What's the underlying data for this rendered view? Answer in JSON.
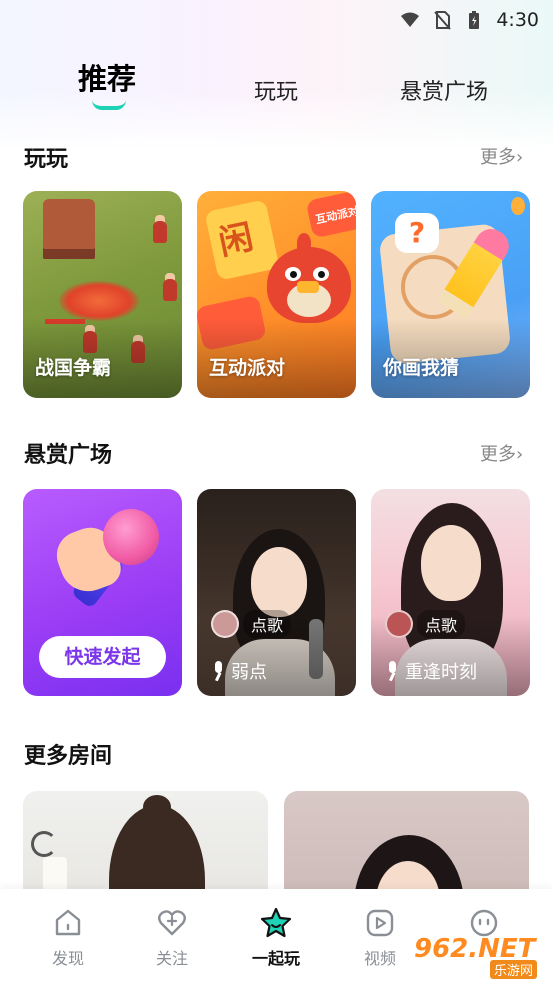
{
  "status_bar": {
    "time": "4:30"
  },
  "top_tabs": [
    {
      "label": "推荐",
      "active": true
    },
    {
      "label": "玩玩",
      "active": false
    },
    {
      "label": "悬赏广场",
      "active": false
    }
  ],
  "section_play": {
    "title": "玩玩",
    "more": "更多›",
    "games": [
      {
        "label": "战国争霸"
      },
      {
        "label": "互动派对",
        "art_text_1": "闲",
        "art_text_2": "互动派对"
      },
      {
        "label": "你画我猜",
        "art_text": "?"
      }
    ]
  },
  "section_reward": {
    "title": "悬赏广场",
    "more": "更多›",
    "quick_button": "快速发起",
    "rooms": [
      {
        "tag": "点歌",
        "name": "弱点"
      },
      {
        "tag": "点歌",
        "name": "重逢时刻"
      }
    ]
  },
  "section_more_rooms": {
    "title": "更多房间"
  },
  "bottom_nav": [
    {
      "label": "发现",
      "icon": "home-icon",
      "active": false
    },
    {
      "label": "关注",
      "icon": "heart-plus-icon",
      "active": false
    },
    {
      "label": "一起玩",
      "icon": "star-icon",
      "active": true
    },
    {
      "label": "视频",
      "icon": "play-icon",
      "active": false
    },
    {
      "label": "",
      "icon": "smile-icon",
      "active": false
    }
  ],
  "watermark": {
    "text": "962.NET",
    "subtext": "乐游网"
  },
  "colors": {
    "accent": "#1ed2b5",
    "purple": "#9a3df5",
    "muted": "#888888"
  }
}
